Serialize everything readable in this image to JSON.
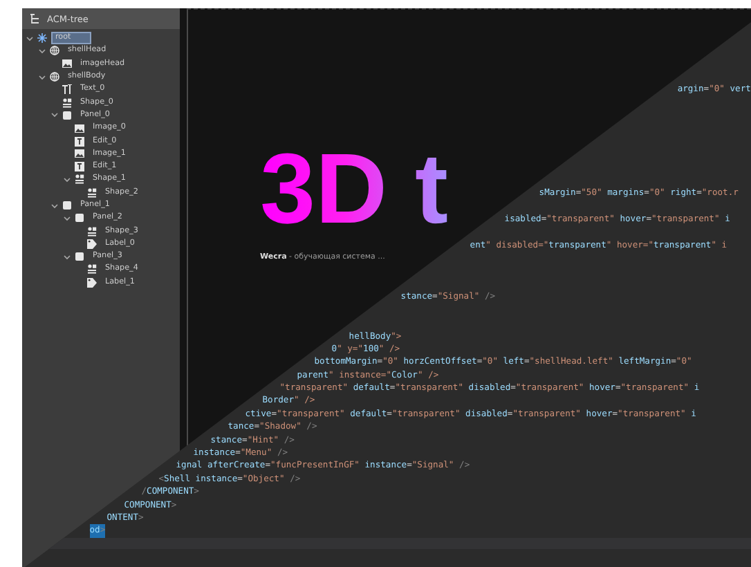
{
  "tree_panel": {
    "title": "ACM-tree",
    "items": [
      {
        "label": "root",
        "kind": "root",
        "selected": true,
        "expanded": true,
        "children": [
          {
            "label": "shellHead",
            "kind": "globe",
            "selected": false,
            "expanded": true,
            "children": [
              {
                "label": "imageHead",
                "kind": "image",
                "selected": false
              }
            ]
          },
          {
            "label": "shellBody",
            "kind": "globe",
            "selected": false,
            "expanded": true,
            "children": [
              {
                "label": "Text_0",
                "kind": "text",
                "selected": false
              },
              {
                "label": "Shape_0",
                "kind": "shape",
                "selected": false
              },
              {
                "label": "Panel_0",
                "kind": "panel",
                "selected": false,
                "expanded": true,
                "children": [
                  {
                    "label": "Image_0",
                    "kind": "image",
                    "selected": false
                  },
                  {
                    "label": "Edit_0",
                    "kind": "edit",
                    "selected": false
                  },
                  {
                    "label": "Image_1",
                    "kind": "image",
                    "selected": false
                  },
                  {
                    "label": "Edit_1",
                    "kind": "edit",
                    "selected": false
                  },
                  {
                    "label": "Shape_1",
                    "kind": "shape",
                    "selected": false,
                    "expanded": true,
                    "children": [
                      {
                        "label": "Shape_2",
                        "kind": "shape",
                        "selected": false
                      }
                    ]
                  }
                ]
              },
              {
                "label": "Panel_1",
                "kind": "panel",
                "selected": false,
                "expanded": true,
                "children": [
                  {
                    "label": "Panel_2",
                    "kind": "panel",
                    "selected": false,
                    "expanded": true,
                    "children": [
                      {
                        "label": "Shape_3",
                        "kind": "shape",
                        "selected": false
                      },
                      {
                        "label": "Label_0",
                        "kind": "label",
                        "selected": false
                      }
                    ]
                  },
                  {
                    "label": "Panel_3",
                    "kind": "panel",
                    "selected": false,
                    "expanded": true,
                    "children": [
                      {
                        "label": "Shape_4",
                        "kind": "shape",
                        "selected": false
                      },
                      {
                        "label": "Label_1",
                        "kind": "label",
                        "selected": false
                      }
                    ]
                  }
                ]
              }
            ]
          }
        ]
      }
    ]
  },
  "preview": {
    "headline": "3D t",
    "caption_brand": "Wecra",
    "caption_text": "- обучающая система ..."
  },
  "code_editor": {
    "lines": [
      {
        "text": "argin=\"0\" vert",
        "selected": false
      },
      {
        "text": "sMargin=\"50\" margins=\"0\" right=\"root.r",
        "selected": false
      },
      {
        "text": "isabled=\"transparent\" hover=\"transparent\" i",
        "selected": false
      },
      {
        "text": "ent\" disabled=\"transparent\" hover=\"transparent\" i",
        "selected": false
      },
      {
        "text": "stance=\"Signal\" />",
        "selected": false
      },
      {
        "text": "hellBody\">",
        "selected": false
      },
      {
        "text": "0\" y=\"100\" />",
        "selected": false
      },
      {
        "text": "bottomMargin=\"0\" horzCentOffset=\"0\" left=\"shellHead.left\" leftMargin=\"0\"",
        "selected": false
      },
      {
        "text": "parent\" instance=\"Color\" />",
        "selected": false
      },
      {
        "text": "\"transparent\" default=\"transparent\" disabled=\"transparent\" hover=\"transparent\" i",
        "selected": false
      },
      {
        "text": "Border\" />",
        "selected": false
      },
      {
        "text": "ctive=\"transparent\" default=\"transparent\" disabled=\"transparent\" hover=\"transparent\" i",
        "selected": false
      },
      {
        "text": "tance=\"Shadow\" />",
        "selected": false
      },
      {
        "text": "stance=\"Hint\" />",
        "selected": false
      },
      {
        "text": "instance=\"Menu\" />",
        "selected": false
      },
      {
        "text": "ignal afterCreate=\"funcPresentInGF\" instance=\"Signal\" />",
        "selected": false
      },
      {
        "text": "<Shell instance=\"Object\" />",
        "selected": false
      },
      {
        "text": "/COMPONENT>",
        "selected": false
      },
      {
        "text": "COMPONENT>",
        "selected": false
      },
      {
        "text": "ONTENT>",
        "selected": false
      },
      {
        "text": "od>",
        "selected": true
      }
    ]
  }
}
